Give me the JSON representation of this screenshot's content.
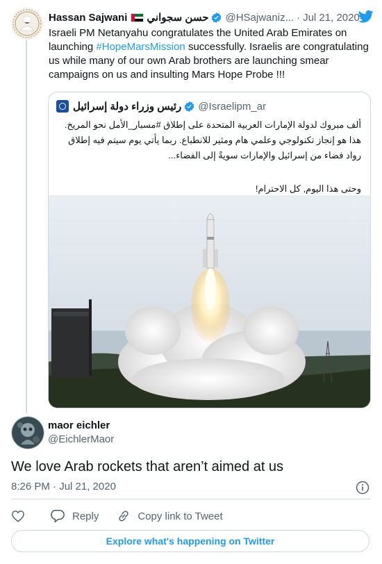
{
  "parent_tweet": {
    "author_name": "Hassan Sajwani",
    "author_name_arabic": "حسن سجواني",
    "handle": "@HSajwaniz...",
    "date": "Jul 21, 2020",
    "text_before_hashtag": "Israeli PM Netanyahu congratulates the United Arab Emirates on launching ",
    "hashtag": "#HopeMarsMission",
    "text_after_hashtag": " successfully. Israelis are congratulating us while many of our own Arab brothers are launching smear campaigns on us and insulting Mars Hope Probe !!!"
  },
  "quoted_tweet": {
    "author_name": "رئيس وزراء دولة إسرائيل",
    "handle": "@Israelipm_ar",
    "paragraph_1": "ألف مبروك لدولة الإمارات العربية المتحدة على إطلاق #مسبار_الأمل نحو المريخ. هذا هو إنجاز تكنولوجي وعلمي هام ومثير للانطباع. ربما يأتي يوم سيتم فيه إطلاق رواد فضاء من إسرائيل والإمارات سويةً إلى الفضاء...",
    "paragraph_2": "وحتى هذا اليوم, كل الاحترام!"
  },
  "reply_tweet": {
    "author_name": "maor eichler",
    "handle": "@EichlerMaor",
    "text": "We love Arab rockets that aren’t aimed at us",
    "timestamp": "8:26 PM · Jul 21, 2020"
  },
  "actions": {
    "reply_label": "Reply",
    "copy_label": "Copy link to Tweet"
  },
  "explore_label": "Explore what's happening on Twitter",
  "colors": {
    "twitter_blue": "#1d9bf0",
    "text_primary": "#0f1419",
    "text_secondary": "#536471",
    "border": "#cfd9de"
  }
}
